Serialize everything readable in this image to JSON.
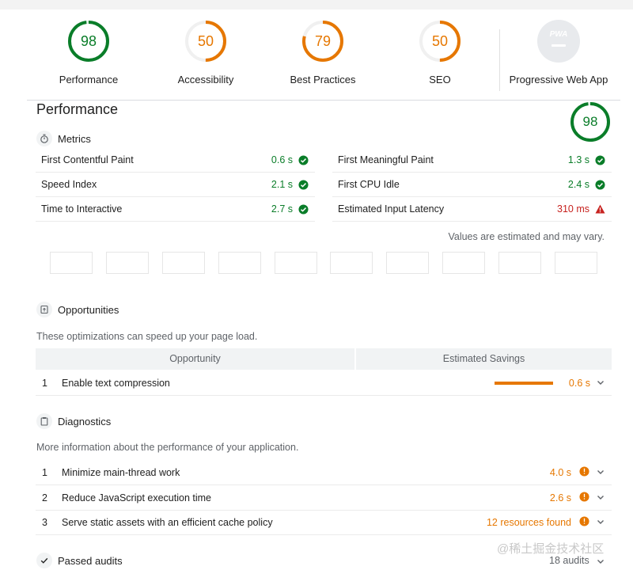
{
  "categories": [
    {
      "score": "98",
      "label": "Performance",
      "tone": "pass",
      "fraction": 0.98
    },
    {
      "score": "50",
      "label": "Accessibility",
      "tone": "avg",
      "fraction": 0.5
    },
    {
      "score": "79",
      "label": "Best Practices",
      "tone": "avg",
      "fraction": 0.79
    },
    {
      "score": "50",
      "label": "SEO",
      "tone": "avg",
      "fraction": 0.5
    },
    {
      "score": "",
      "label": "Progressive Web App",
      "badge": "PWA"
    }
  ],
  "performance": {
    "title": "Performance",
    "score": "98",
    "fraction": 0.98
  },
  "metrics": {
    "heading": "Metrics",
    "left": [
      {
        "name": "First Contentful Paint",
        "value": "0.6 s",
        "status": "pass"
      },
      {
        "name": "Speed Index",
        "value": "2.1 s",
        "status": "pass"
      },
      {
        "name": "Time to Interactive",
        "value": "2.7 s",
        "status": "pass"
      }
    ],
    "right": [
      {
        "name": "First Meaningful Paint",
        "value": "1.3 s",
        "status": "pass"
      },
      {
        "name": "First CPU Idle",
        "value": "2.4 s",
        "status": "pass"
      },
      {
        "name": "Estimated Input Latency",
        "value": "310 ms",
        "status": "fail"
      }
    ],
    "note": "Values are estimated and may vary."
  },
  "opportunities": {
    "heading": "Opportunities",
    "description": "These optimizations can speed up your page load.",
    "col_opportunity": "Opportunity",
    "col_savings": "Estimated Savings",
    "items": [
      {
        "index": "1",
        "title": "Enable text compression",
        "savings": "0.6 s"
      }
    ]
  },
  "diagnostics": {
    "heading": "Diagnostics",
    "description": "More information about the performance of your application.",
    "items": [
      {
        "index": "1",
        "title": "Minimize main-thread work",
        "value": "4.0 s"
      },
      {
        "index": "2",
        "title": "Reduce JavaScript execution time",
        "value": "2.6 s"
      },
      {
        "index": "3",
        "title": "Serve static assets with an efficient cache policy",
        "value": "12 resources found"
      }
    ]
  },
  "passed": {
    "heading": "Passed audits",
    "count": "18 audits"
  },
  "watermark": "@稀土掘金技术社区",
  "colors": {
    "pass": "#0a7d29",
    "average": "#e67700",
    "fail": "#c7221f",
    "ring_pass_bg": "#e0f2e6",
    "ring_avg_bg": "#f5e5d4"
  }
}
